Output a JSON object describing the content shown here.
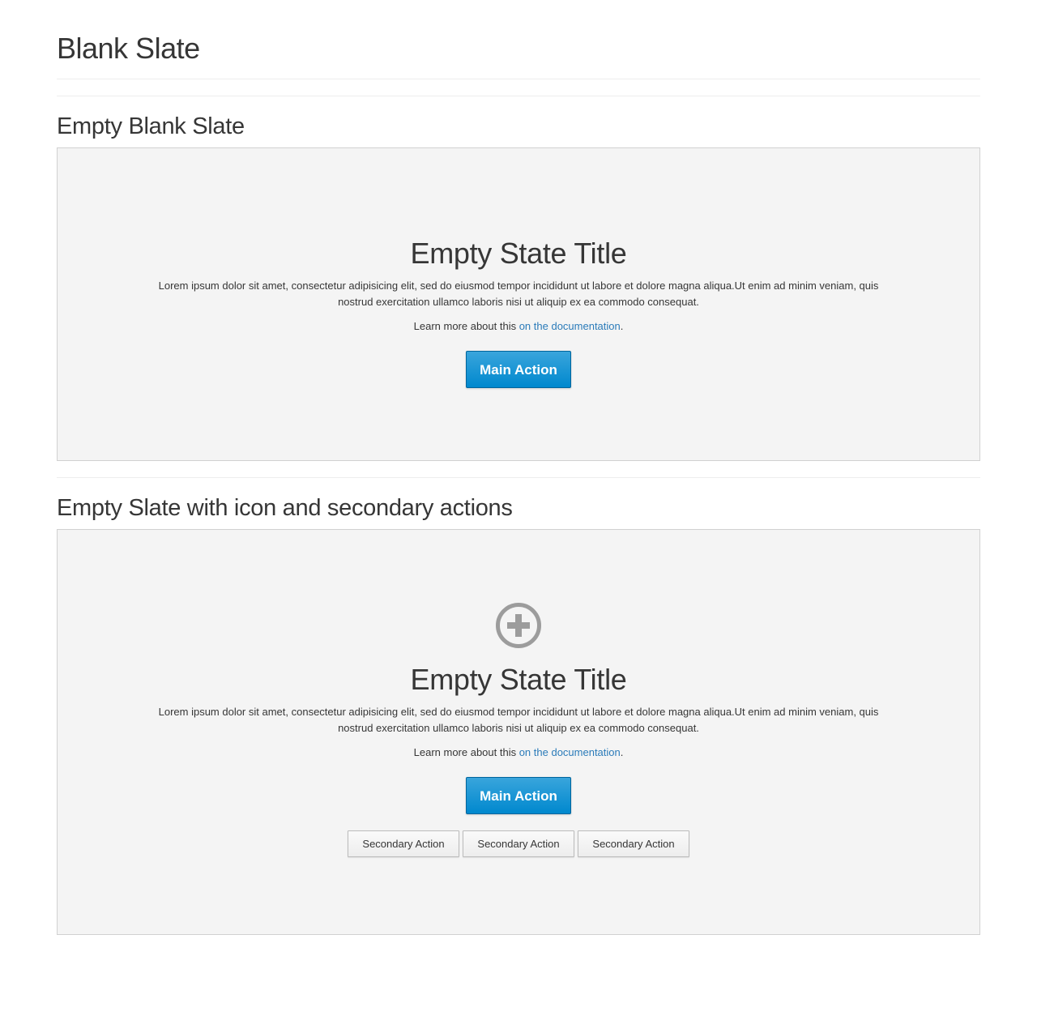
{
  "page": {
    "title": "Blank Slate"
  },
  "sections": [
    {
      "heading": "Empty Blank Slate",
      "slate": {
        "title": "Empty State Title",
        "body": "Lorem ipsum dolor sit amet, consectetur adipisicing elit, sed do eiusmod tempor incididunt ut labore et dolore magna aliqua.Ut enim ad minim veniam, quis nostrud exercitation ullamco laboris nisi ut aliquip ex ea commodo consequat.",
        "learn_prefix": "Learn more about this ",
        "learn_link": "on the documentation",
        "learn_suffix": ".",
        "main_action": "Main Action"
      }
    },
    {
      "heading": "Empty Slate with icon and secondary actions",
      "slate": {
        "icon": "add-circle-icon",
        "title": "Empty State Title",
        "body": "Lorem ipsum dolor sit amet, consectetur adipisicing elit, sed do eiusmod tempor incididunt ut labore et dolore magna aliqua.Ut enim ad minim veniam, quis nostrud exercitation ullamco laboris nisi ut aliquip ex ea commodo consequat.",
        "learn_prefix": "Learn more about this ",
        "learn_link": "on the documentation",
        "learn_suffix": ".",
        "main_action": "Main Action",
        "secondary_actions": [
          "Secondary Action",
          "Secondary Action",
          "Secondary Action"
        ]
      }
    }
  ],
  "colors": {
    "primary": "#0088ce",
    "link": "#2b7bb9",
    "slate_bg": "#f4f4f4",
    "icon": "#9c9c9c"
  }
}
